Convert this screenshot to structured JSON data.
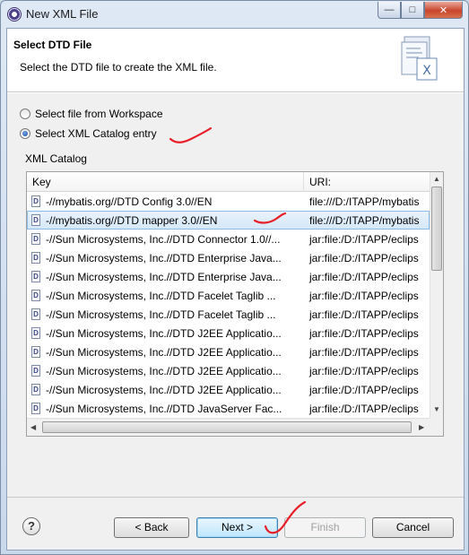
{
  "window": {
    "title": "New XML File"
  },
  "header": {
    "title": "Select DTD File",
    "description": "Select the DTD file to create the XML file."
  },
  "options": [
    {
      "label": "Select file from Workspace",
      "selected": false
    },
    {
      "label": "Select XML Catalog entry",
      "selected": true
    }
  ],
  "catalog": {
    "group_label": "XML Catalog",
    "columns": {
      "key": "Key",
      "uri": "URI:"
    },
    "rows": [
      {
        "key": "-//mybatis.org//DTD Config 3.0//EN",
        "uri": "file:///D:/ITAPP/mybatis"
      },
      {
        "key": "-//mybatis.org//DTD mapper 3.0//EN",
        "uri": "file:///D:/ITAPP/mybatis",
        "selected": true
      },
      {
        "key": "-//Sun Microsystems, Inc.//DTD Connector 1.0//...",
        "uri": "jar:file:/D:/ITAPP/eclips"
      },
      {
        "key": "-//Sun Microsystems, Inc.//DTD Enterprise Java...",
        "uri": "jar:file:/D:/ITAPP/eclips"
      },
      {
        "key": "-//Sun Microsystems, Inc.//DTD Enterprise Java...",
        "uri": "jar:file:/D:/ITAPP/eclips"
      },
      {
        "key": "-//Sun Microsystems, Inc.//DTD Facelet Taglib ...",
        "uri": "jar:file:/D:/ITAPP/eclips"
      },
      {
        "key": "-//Sun Microsystems, Inc.//DTD Facelet Taglib ...",
        "uri": "jar:file:/D:/ITAPP/eclips"
      },
      {
        "key": "-//Sun Microsystems, Inc.//DTD J2EE Applicatio...",
        "uri": "jar:file:/D:/ITAPP/eclips"
      },
      {
        "key": "-//Sun Microsystems, Inc.//DTD J2EE Applicatio...",
        "uri": "jar:file:/D:/ITAPP/eclips"
      },
      {
        "key": "-//Sun Microsystems, Inc.//DTD J2EE Applicatio...",
        "uri": "jar:file:/D:/ITAPP/eclips"
      },
      {
        "key": "-//Sun Microsystems, Inc.//DTD J2EE Applicatio...",
        "uri": "jar:file:/D:/ITAPP/eclips"
      },
      {
        "key": "-//Sun Microsystems, Inc.//DTD JavaServer Fac...",
        "uri": "jar:file:/D:/ITAPP/eclips"
      }
    ]
  },
  "buttons": {
    "help": "?",
    "back": "< Back",
    "next": "Next >",
    "finish": "Finish",
    "cancel": "Cancel"
  },
  "icons": {
    "row_icon": "dtd-file-icon",
    "header_art": "xml-file-wizard-icon"
  },
  "colors": {
    "selection": "#d5e7f8",
    "annotation": "#e8202a"
  }
}
